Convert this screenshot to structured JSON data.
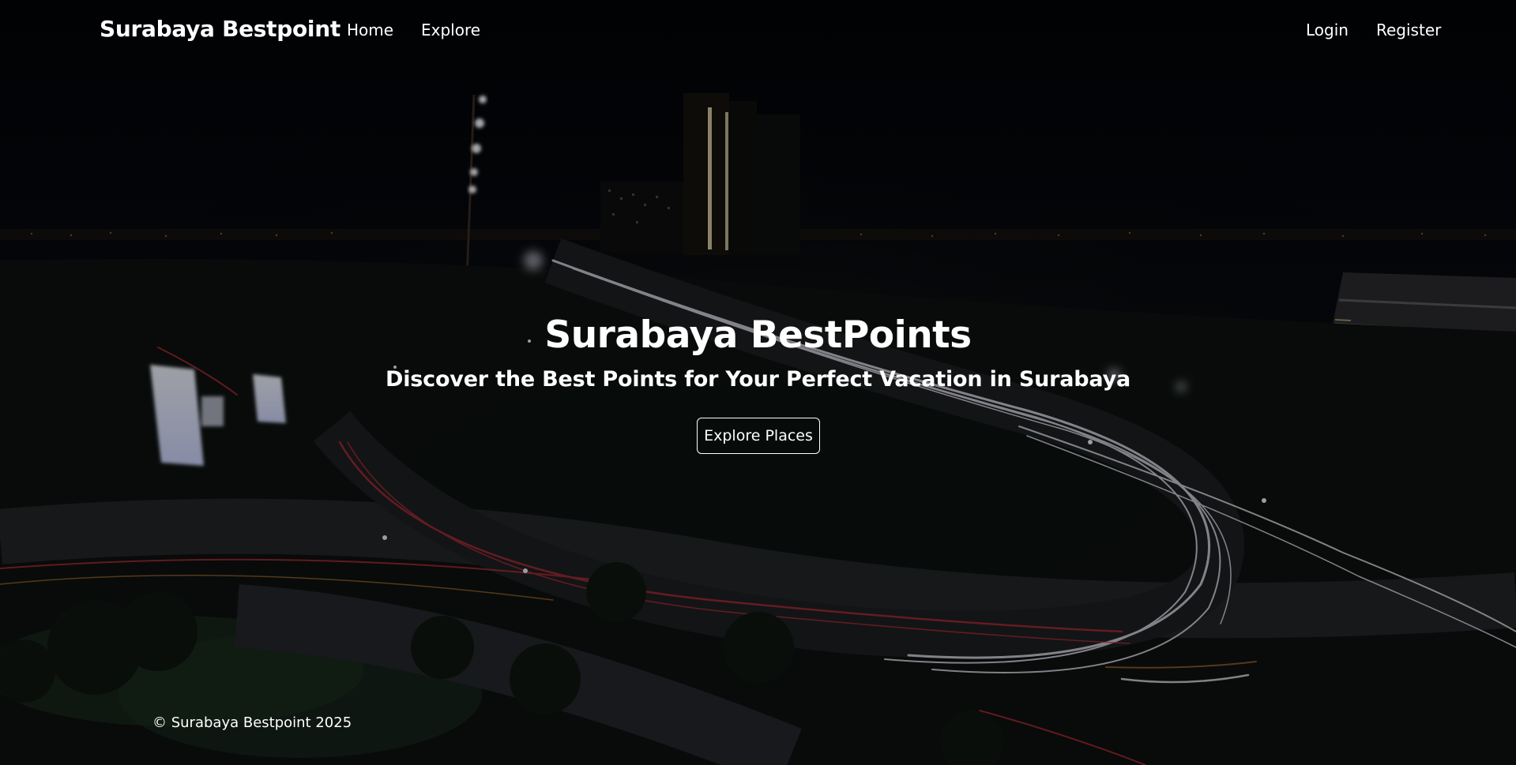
{
  "nav": {
    "brand": "Surabaya Bestpoint",
    "links": [
      {
        "label": "Home"
      },
      {
        "label": "Explore"
      }
    ],
    "login_label": "Login",
    "register_label": "Register"
  },
  "hero": {
    "title": "Surabaya BestPoints",
    "subtitle": "Discover the Best Points for Your Perfect Vacation in Surabaya",
    "cta_label": "Explore Places"
  },
  "footer": {
    "copyright": "© Surabaya Bestpoint 2025"
  },
  "colors": {
    "background": "#05070c",
    "text": "#ffffff",
    "light_trail_white": "#e8e6f2",
    "light_trail_red": "#c4303a"
  }
}
